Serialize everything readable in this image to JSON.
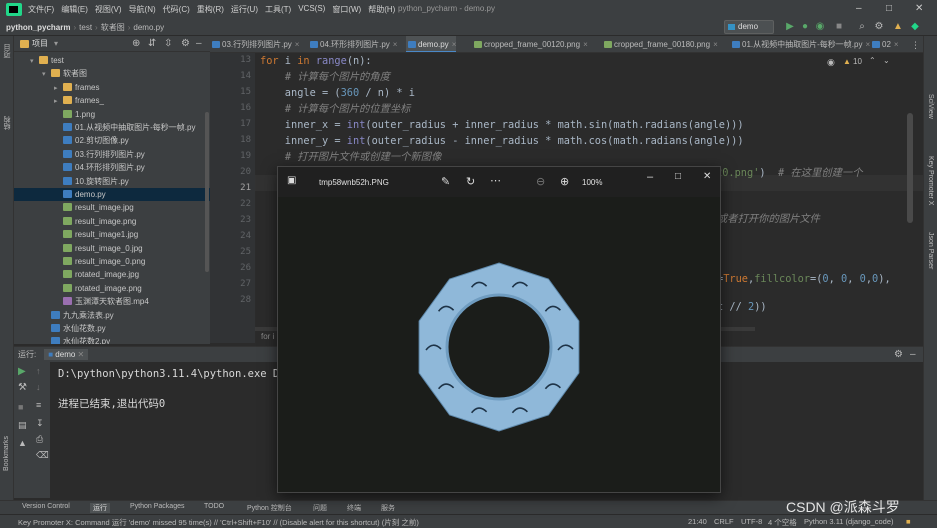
{
  "menubar": {
    "items": [
      "文件(F)",
      "编辑(E)",
      "视图(V)",
      "导航(N)",
      "代码(C)",
      "重构(R)",
      "运行(U)",
      "工具(T)",
      "VCS(S)",
      "窗口(W)",
      "帮助(H)"
    ],
    "window_title": "python_pycharm - demo.py"
  },
  "navbar": {
    "crumbs": [
      "python_pycharm",
      "test",
      "软者图",
      "demo.py"
    ],
    "run_config": "demo"
  },
  "project_panel": {
    "title": "项目",
    "tree": [
      {
        "label": "test",
        "type": "folder",
        "indent": 1,
        "expanded": true
      },
      {
        "label": "软者图",
        "type": "folder",
        "indent": 2,
        "expanded": true
      },
      {
        "label": "frames",
        "type": "folder",
        "indent": 3,
        "expanded": false
      },
      {
        "label": "frames_",
        "type": "folder",
        "indent": 3,
        "expanded": false
      },
      {
        "label": "1.png",
        "type": "img",
        "indent": 3
      },
      {
        "label": "01.从视频中抽取图片-每秒一帧.py",
        "type": "py",
        "indent": 3
      },
      {
        "label": "02.剪切图像.py",
        "type": "py",
        "indent": 3
      },
      {
        "label": "03.行列排列图片.py",
        "type": "py",
        "indent": 3
      },
      {
        "label": "04.环形排列图片.py",
        "type": "py",
        "indent": 3
      },
      {
        "label": "10.旋转图片.py",
        "type": "py",
        "indent": 3
      },
      {
        "label": "demo.py",
        "type": "py",
        "indent": 3,
        "selected": true
      },
      {
        "label": "result_image.jpg",
        "type": "img",
        "indent": 3
      },
      {
        "label": "result_image.png",
        "type": "img",
        "indent": 3
      },
      {
        "label": "result_image1.jpg",
        "type": "img",
        "indent": 3
      },
      {
        "label": "result_image_0.jpg",
        "type": "img",
        "indent": 3
      },
      {
        "label": "result_image_0.png",
        "type": "img",
        "indent": 3
      },
      {
        "label": "rotated_image.jpg",
        "type": "img",
        "indent": 3
      },
      {
        "label": "rotated_image.png",
        "type": "img",
        "indent": 3
      },
      {
        "label": "玉渊潭天软者图.mp4",
        "type": "mp4",
        "indent": 3
      },
      {
        "label": "九九乘法表.py",
        "type": "py",
        "indent": 2
      },
      {
        "label": "水仙花数.py",
        "type": "py",
        "indent": 2
      },
      {
        "label": "水仙花数2.py",
        "type": "py",
        "indent": 2
      }
    ]
  },
  "tabs": [
    {
      "label": "03.行列排列图片.py",
      "kind": "py"
    },
    {
      "label": "04.环形排列图片.py",
      "kind": "py"
    },
    {
      "label": "demo.py",
      "kind": "py",
      "active": true
    },
    {
      "label": "cropped_frame_00120.png",
      "kind": "img"
    },
    {
      "label": "cropped_frame_00180.png",
      "kind": "img"
    },
    {
      "label": "01.从视频中抽取图片-每秒一帧.py",
      "kind": "py"
    },
    {
      "label": "02",
      "kind": "py"
    }
  ],
  "editor": {
    "line_numbers": [
      "13",
      "14",
      "15",
      "16",
      "17",
      "18",
      "19",
      "20",
      "21",
      "22",
      "23",
      "24",
      "25",
      "26",
      "27",
      "28"
    ],
    "inspections": "10",
    "fold_hint": "for i"
  },
  "run_panel": {
    "title": "运行:",
    "tab": "demo",
    "output": [
      "D:\\python\\python3.11.4\\python.exe D:/",
      "",
      "进程已结束,退出代码0"
    ]
  },
  "tool_tabs": [
    "Version Control",
    "运行",
    "Python Packages",
    "TODO",
    "Python 控制台",
    "问题",
    "终端",
    "服务"
  ],
  "status": {
    "message": "Key Promoter X: Command 运行 'demo' missed 95 time(s) // 'Ctrl+Shift+F10' // (Disable alert for this shortcut) (片刻 之前)",
    "position": "21:40",
    "line_sep": "CRLF",
    "encoding": "UTF-8",
    "indent": "4 个空格",
    "interpreter": "Python 3.11 (django_code)"
  },
  "viewer": {
    "filename": "tmp58wnb52h.PNG",
    "zoom": "100%",
    "ring_color": "#8fb8d9"
  },
  "right_strip": [
    "SciView",
    "Key Promoter X",
    "Json Parser"
  ],
  "left_strip": [
    "项目",
    "结构",
    "Bookmarks"
  ],
  "watermark": "CSDN @派森斗罗"
}
